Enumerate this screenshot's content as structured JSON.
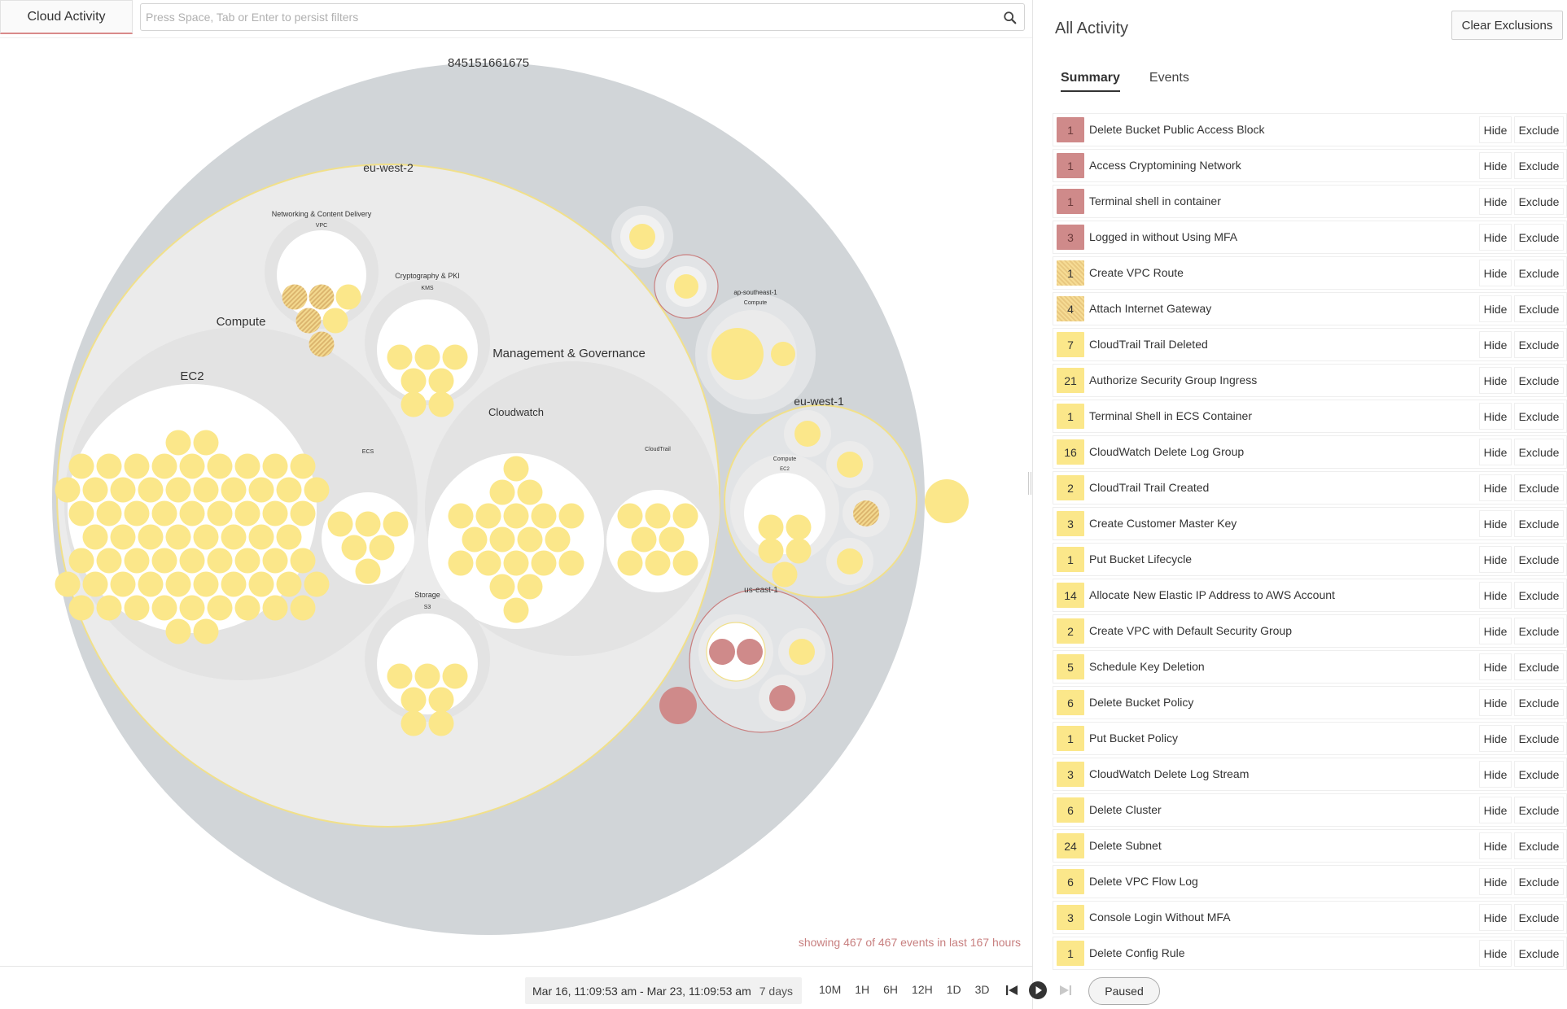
{
  "app": {
    "tab_label": "Cloud Activity",
    "filter_placeholder": "Press Space, Tab or Enter to persist filters"
  },
  "viz": {
    "account": "845151661675",
    "regions": {
      "eu_west_2": "eu-west-2",
      "eu_west_1": "eu-west-1",
      "us_east_1": "us-east-1",
      "ap_southeast_1": "ap-southeast-1"
    },
    "groups": {
      "compute": "Compute",
      "ec2": "EC2",
      "ecs": "ECS",
      "mgmt": "Management & Governance",
      "cloudwatch": "Cloudwatch",
      "cloudtrail": "CloudTrail",
      "networking": "Networking & Content Delivery",
      "vpc": "VPC",
      "crypto": "Cryptography & PKI",
      "kms": "KMS",
      "storage": "Storage",
      "s3": "S3",
      "ap_compute": "Compute",
      "euw1_compute": "Compute",
      "euw1_ec2": "EC2"
    },
    "showing_text": "showing 467 of 467 events in last 167 hours",
    "colors": {
      "background_circle": "#d1d5d8",
      "group_circle": "#ebebeb",
      "leaf_circle": "#ffffff",
      "event_yellow": "#fbe78a",
      "event_red": "#cf8a8a",
      "region_outline_yellow": "#f1e08a",
      "region_outline_red": "#c98080"
    }
  },
  "bottom_bar": {
    "date_range": "Mar 16, 11:09:53 am - Mar 23, 11:09:53 am",
    "duration": "7 days",
    "ranges": [
      "10M",
      "1H",
      "6H",
      "12H",
      "1D",
      "3D"
    ],
    "paused_label": "Paused"
  },
  "panel": {
    "title": "All Activity",
    "clear_label": "Clear Exclusions",
    "tabs": [
      "Summary",
      "Events"
    ],
    "hide_label": "Hide",
    "exclude_label": "Exclude",
    "activities": [
      {
        "count": "1",
        "label": "Delete Bucket Public Access Block",
        "severity": "red"
      },
      {
        "count": "1",
        "label": "Access Cryptomining Network",
        "severity": "red"
      },
      {
        "count": "1",
        "label": "Terminal shell in container",
        "severity": "red"
      },
      {
        "count": "3",
        "label": "Logged in without Using MFA",
        "severity": "red"
      },
      {
        "count": "1",
        "label": "Create VPC Route",
        "severity": "hatched"
      },
      {
        "count": "4",
        "label": "Attach Internet Gateway",
        "severity": "hatched"
      },
      {
        "count": "7",
        "label": "CloudTrail Trail Deleted",
        "severity": "yellow"
      },
      {
        "count": "21",
        "label": "Authorize Security Group Ingress",
        "severity": "yellow"
      },
      {
        "count": "1",
        "label": "Terminal Shell in ECS Container",
        "severity": "yellow"
      },
      {
        "count": "16",
        "label": "CloudWatch Delete Log Group",
        "severity": "yellow"
      },
      {
        "count": "2",
        "label": "CloudTrail Trail Created",
        "severity": "yellow"
      },
      {
        "count": "3",
        "label": "Create Customer Master Key",
        "severity": "yellow"
      },
      {
        "count": "1",
        "label": "Put Bucket Lifecycle",
        "severity": "yellow"
      },
      {
        "count": "14",
        "label": "Allocate New Elastic IP Address to AWS Account",
        "severity": "yellow"
      },
      {
        "count": "2",
        "label": "Create VPC with Default Security Group",
        "severity": "yellow"
      },
      {
        "count": "5",
        "label": "Schedule Key Deletion",
        "severity": "yellow"
      },
      {
        "count": "6",
        "label": "Delete Bucket Policy",
        "severity": "yellow"
      },
      {
        "count": "1",
        "label": "Put Bucket Policy",
        "severity": "yellow"
      },
      {
        "count": "3",
        "label": "CloudWatch Delete Log Stream",
        "severity": "yellow"
      },
      {
        "count": "6",
        "label": "Delete Cluster",
        "severity": "yellow"
      },
      {
        "count": "24",
        "label": "Delete Subnet",
        "severity": "yellow"
      },
      {
        "count": "6",
        "label": "Delete VPC Flow Log",
        "severity": "yellow"
      },
      {
        "count": "3",
        "label": "Console Login Without MFA",
        "severity": "yellow"
      },
      {
        "count": "1",
        "label": "Delete Config Rule",
        "severity": "yellow"
      }
    ]
  }
}
